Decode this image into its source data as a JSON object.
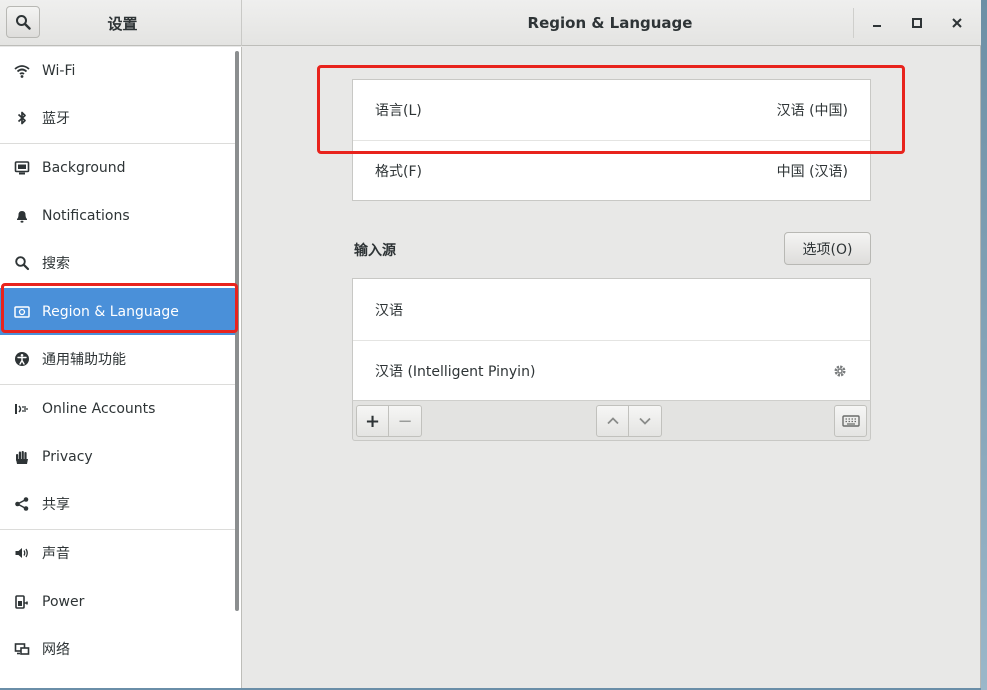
{
  "header": {
    "left_title": "设置",
    "title": "Region & Language",
    "search_icon": "search-icon",
    "minimize_icon": "minimize-icon",
    "maximize_icon": "maximize-icon",
    "close_icon": "close-icon"
  },
  "sidebar": {
    "items": [
      {
        "label": "Wi-Fi",
        "icon": "wifi-icon"
      },
      {
        "label": "蓝牙",
        "icon": "bluetooth-icon"
      },
      {
        "label": "Background",
        "icon": "background-icon"
      },
      {
        "label": "Notifications",
        "icon": "bell-icon"
      },
      {
        "label": "搜索",
        "icon": "search-icon"
      },
      {
        "label": "Region & Language",
        "icon": "region-flag-icon",
        "selected": true
      },
      {
        "label": "通用辅助功能",
        "icon": "accessibility-icon"
      },
      {
        "label": "Online Accounts",
        "icon": "online-accounts-icon"
      },
      {
        "label": "Privacy",
        "icon": "hand-icon"
      },
      {
        "label": "共享",
        "icon": "share-icon"
      },
      {
        "label": "声音",
        "icon": "speaker-icon"
      },
      {
        "label": "Power",
        "icon": "power-plug-icon"
      },
      {
        "label": "网络",
        "icon": "network-icon"
      }
    ]
  },
  "main": {
    "language": {
      "label": "语言(L)",
      "value": "汉语 (中国)"
    },
    "format": {
      "label": "格式(F)",
      "value": "中国 (汉语)"
    },
    "input_sources_title": "输入源",
    "options_button": "选项(O)",
    "input_sources": [
      {
        "label": "汉语"
      },
      {
        "label": "汉语 (Intelligent Pinyin)",
        "icon": "gear-icon"
      }
    ],
    "toolbar": {
      "add": "+",
      "remove": "−",
      "up_icon": "chevron-up-icon",
      "down_icon": "chevron-down-icon",
      "keyboard_icon": "keyboard-icon"
    }
  },
  "colors": {
    "accent": "#4a90d9",
    "highlight_box": "#e8231d",
    "window_bg": "#e8e8e7"
  }
}
